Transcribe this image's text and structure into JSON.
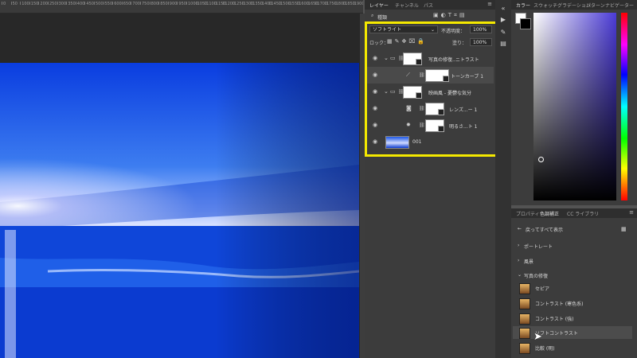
{
  "ruler": {
    "labels": [
      "0",
      "50",
      "100",
      "150",
      "200",
      "250",
      "300",
      "350",
      "400",
      "450",
      "500",
      "550",
      "600",
      "650",
      "700",
      "750",
      "800",
      "850",
      "900",
      "950",
      "1000",
      "1050",
      "1100",
      "1150",
      "1200",
      "1250",
      "1300",
      "1350",
      "1400",
      "1450",
      "1500",
      "1550",
      "1600",
      "1650",
      "1700",
      "1750",
      "1800",
      "1850",
      "1900",
      "1950"
    ]
  },
  "layers_panel": {
    "tabs": [
      "レイヤー",
      "チャンネル",
      "パス"
    ],
    "filter_label": "種類",
    "blend_mode": "ソフトライト",
    "opacity_label": "不透明度：",
    "opacity_value": "100%",
    "lock_label": "ロック：",
    "fill_label": "塗り：",
    "fill_value": "100%",
    "layers": [
      {
        "name": "写真の修復..ニトラスト"
      },
      {
        "name": "トーンカーブ 1"
      },
      {
        "name": "映画風 - 憂鬱な気分"
      },
      {
        "name": "レンズ...ー 1"
      },
      {
        "name": "明るさ...ト 1"
      },
      {
        "name": "001"
      }
    ]
  },
  "color_panel": {
    "tabs": [
      "カラー",
      "スウォッチ",
      "グラデーション",
      "パターン",
      "ナビゲーター"
    ]
  },
  "adjust_panel": {
    "tabs": [
      "プロパティ",
      "色調補正",
      "CC ライブラリ"
    ],
    "back_label": "戻ってすべて表示",
    "groups": [
      "ポートレート",
      "風景",
      "写真の修復"
    ],
    "presets": [
      "セピア",
      "コントラスト (寒色系)",
      "コントラスト (強)",
      "ソフトコントラスト",
      "比較 (明)"
    ]
  },
  "colors": {
    "highlight": "#f5e900",
    "photo_sky_top": "#0a3bd6",
    "photo_horizon": "#cfd8ff",
    "photo_sea": "#0b3fd4"
  }
}
